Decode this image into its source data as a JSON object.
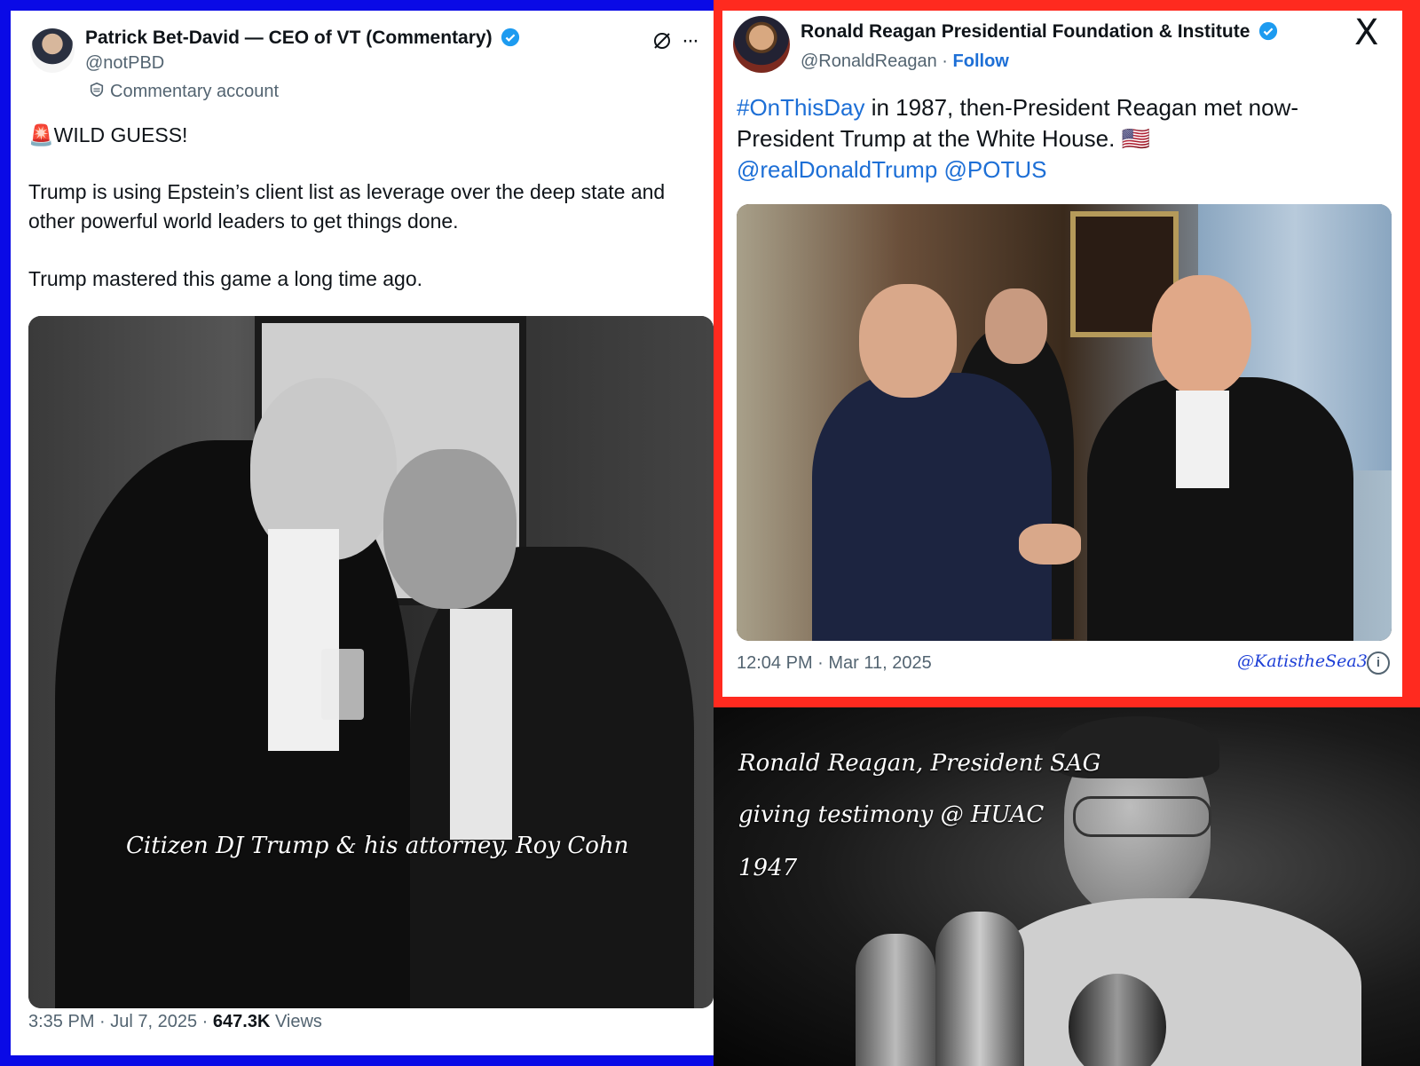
{
  "left_tweet": {
    "display_name": "Patrick Bet-David — CEO of VT (Commentary)",
    "handle": "@notPBD",
    "account_label": "Commentary account",
    "more_label": "···",
    "alert_emoji": "🚨",
    "headline": "WILD GUESS!",
    "paragraph1": "Trump is using Epstein’s client list as leverage over the deep state and other powerful world leaders to get things done.",
    "paragraph2": "Trump mastered this game a long time ago.",
    "photo_caption": "Citizen DJ Trump & his attorney, Roy Cohn",
    "time": "3:35 PM · Jul 7, 2025 · ",
    "views_count": "647.3K",
    "views_label": " Views"
  },
  "right_tweet": {
    "display_name": "Ronald Reagan Presidential Foundation & Institute",
    "handle": "@RonaldReagan",
    "separator": " · ",
    "follow_label": "Follow",
    "hashtag": "#OnThisDay",
    "text": " in 1987, then-President Reagan met now-President Trump at the White House. ",
    "flag": "🇺🇸",
    "mention1": "@realDonaldTrump",
    "mention2": "@POTUS",
    "time": "12:04 PM · Mar 11, 2025",
    "watermark": "@KatistheSea3",
    "x_logo": "X",
    "info_icon": "i"
  },
  "bottom_right": {
    "caption_line1": "Ronald Reagan, President SAG",
    "caption_line2": "giving testimony @ HUAC",
    "caption_line3": "1947"
  },
  "colors": {
    "left_border": "#0a0ae6",
    "right_border": "#ff2a1f",
    "link_blue": "#1d6fd6",
    "verified_blue": "#1d9bf0"
  }
}
